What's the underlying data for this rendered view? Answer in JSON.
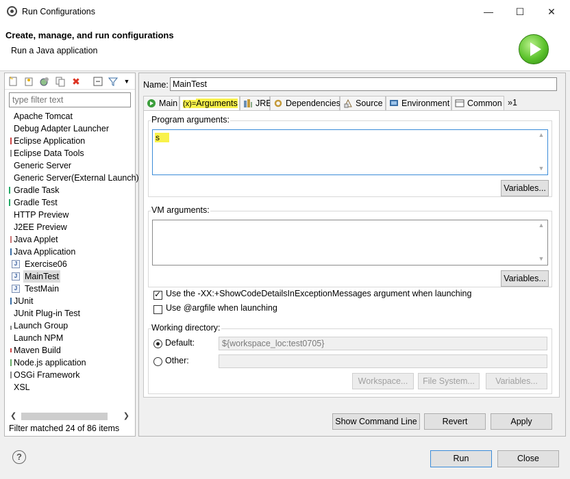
{
  "window": {
    "title": "Run Configurations",
    "minimize": "—",
    "maximize": "☐",
    "close": "✕"
  },
  "header": {
    "title": "Create, manage, and run configurations",
    "subtitle": "Run a Java application"
  },
  "sidebar": {
    "filter_placeholder": "type filter text",
    "items": [
      {
        "label": "Apache Tomcat"
      },
      {
        "label": "Debug Adapter Launcher"
      },
      {
        "label": "Eclipse Application"
      },
      {
        "label": "Eclipse Data Tools"
      },
      {
        "label": "Generic Server"
      },
      {
        "label": "Generic Server(External Launch)"
      },
      {
        "label": "Gradle Task"
      },
      {
        "label": "Gradle Test"
      },
      {
        "label": "HTTP Preview"
      },
      {
        "label": "J2EE Preview"
      },
      {
        "label": "Java Applet"
      },
      {
        "label": "Java Application"
      },
      {
        "label": "Exercise06"
      },
      {
        "label": "MainTest"
      },
      {
        "label": "TestMain"
      },
      {
        "label": "JUnit"
      },
      {
        "label": "JUnit Plug-in Test"
      },
      {
        "label": "Launch Group"
      },
      {
        "label": "Launch NPM"
      },
      {
        "label": "Maven Build"
      },
      {
        "label": "Node.js application"
      },
      {
        "label": "OSGi Framework"
      },
      {
        "label": "XSL"
      }
    ],
    "status": "Filter matched 24 of 86 items"
  },
  "config": {
    "name_label": "Name:",
    "name_value": "MainTest",
    "tabs": [
      {
        "label": "Main",
        "icon": "main-tab-icon"
      },
      {
        "label": "Arguments",
        "icon": "arguments-tab-icon"
      },
      {
        "label": "JRE",
        "icon": "jre-tab-icon"
      },
      {
        "label": "Dependencies",
        "icon": "dependencies-tab-icon"
      },
      {
        "label": "Source",
        "icon": "source-tab-icon"
      },
      {
        "label": "Environment",
        "icon": "environment-tab-icon"
      },
      {
        "label": "Common",
        "icon": "common-tab-icon"
      },
      {
        "label": "»1",
        "icon": "more-tabs-icon"
      }
    ],
    "tab_icons": {
      "arguments": "(x)="
    },
    "program_args_label": "Program arguments:",
    "program_args_value": "s",
    "variables_label": "Variables...",
    "vm_args_label": "VM arguments:",
    "vm_args_value": "",
    "show_code_details_label": "Use the -XX:+ShowCodeDetailsInExceptionMessages argument when launching",
    "show_code_details_checked": true,
    "argfile_label": "Use @argfile when launching",
    "argfile_checked": false,
    "working_dir_label": "Working directory:",
    "default_label": "Default:",
    "default_value": "${workspace_loc:test0705}",
    "other_label": "Other:",
    "workspace_button": "Workspace...",
    "filesystem_button": "File System...",
    "variables_button_wd": "Variables..."
  },
  "actions": {
    "show_command_line": "Show Command Line",
    "revert": "Revert",
    "apply": "Apply",
    "run": "Run",
    "close": "Close",
    "help": "?"
  },
  "colors": {
    "highlight": "#f9f24a",
    "focus": "#3a8bd8",
    "run_green": "#5cc22c"
  }
}
